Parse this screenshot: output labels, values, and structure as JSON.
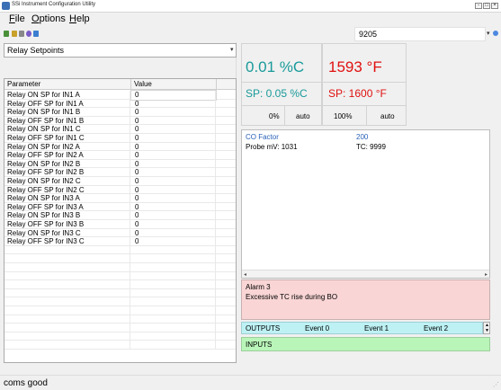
{
  "window": {
    "title": "SSi Instrument Configuration Utility",
    "controls": [
      "-",
      "□",
      "×"
    ]
  },
  "menu": [
    {
      "label": "File",
      "mnemonic": "F",
      "rest": "ile"
    },
    {
      "label": "Options",
      "mnemonic": "O",
      "rest": "ptions"
    },
    {
      "label": "Help",
      "mnemonic": "H",
      "rest": "elp"
    }
  ],
  "toolbar": {
    "icons": [
      {
        "name": "connect-icon",
        "color": "#4a8f3a"
      },
      {
        "name": "lock-icon",
        "color": "#c9a12b"
      },
      {
        "name": "trash-icon",
        "color": "#888888"
      },
      {
        "name": "gear-icon",
        "color": "#7a5cc7"
      },
      {
        "name": "chart-icon",
        "color": "#3c7fd0"
      }
    ],
    "device_value": "9205",
    "dropdown_arrow": "▾"
  },
  "left": {
    "setpoint_select": "Relay Setpoints",
    "columns": [
      "Parameter",
      "Value"
    ],
    "rows": [
      {
        "parameter": "Relay ON SP for IN1 A",
        "value": "0"
      },
      {
        "parameter": "Relay OFF SP for IN1 A",
        "value": "0"
      },
      {
        "parameter": "Relay ON SP for IN1 B",
        "value": "0"
      },
      {
        "parameter": "Relay OFF SP for IN1 B",
        "value": "0"
      },
      {
        "parameter": "Relay ON SP for IN1 C",
        "value": "0"
      },
      {
        "parameter": "Relay OFF SP for IN1 C",
        "value": "0"
      },
      {
        "parameter": "Relay ON SP for IN2 A",
        "value": "0"
      },
      {
        "parameter": "Relay OFF SP for IN2 A",
        "value": "0"
      },
      {
        "parameter": "Relay ON SP for IN2 B",
        "value": "0"
      },
      {
        "parameter": "Relay OFF SP for IN2 B",
        "value": "0"
      },
      {
        "parameter": "Relay ON SP for IN2 C",
        "value": "0"
      },
      {
        "parameter": "Relay OFF SP for IN2 C",
        "value": "0"
      },
      {
        "parameter": "Relay ON SP for IN3 A",
        "value": "0"
      },
      {
        "parameter": "Relay OFF SP for IN3 A",
        "value": "0"
      },
      {
        "parameter": "Relay ON SP for IN3 B",
        "value": "0"
      },
      {
        "parameter": "Relay OFF SP for IN3 B",
        "value": "0"
      },
      {
        "parameter": "Relay ON SP for IN3 C",
        "value": "0"
      },
      {
        "parameter": "Relay OFF SP for IN3 C",
        "value": "0"
      }
    ]
  },
  "loops": {
    "carbon": {
      "pv": "0.01 %C",
      "sp": "SP: 0.05 %C",
      "output": "0%",
      "mode": "auto",
      "color": "#1a9a9a"
    },
    "temperature": {
      "pv": "1593 °F",
      "sp": "SP: 1600 °F",
      "output": "100%",
      "mode": "auto",
      "color": "#e01010"
    }
  },
  "info": {
    "co_factor_label": "CO Factor",
    "co_factor_value": "200",
    "probe_mv": "Probe mV: 1031",
    "tc": "TC: 9999",
    "accent_color": "#2a62b8"
  },
  "alarm": {
    "title": "Alarm 3",
    "message": "Excessive TC rise during BO"
  },
  "outputs": {
    "label": "OUTPUTS",
    "events": [
      "Event 0",
      "Event 1",
      "Event 2"
    ]
  },
  "inputs": {
    "label": "INPUTS"
  },
  "status": {
    "text": "coms good"
  }
}
